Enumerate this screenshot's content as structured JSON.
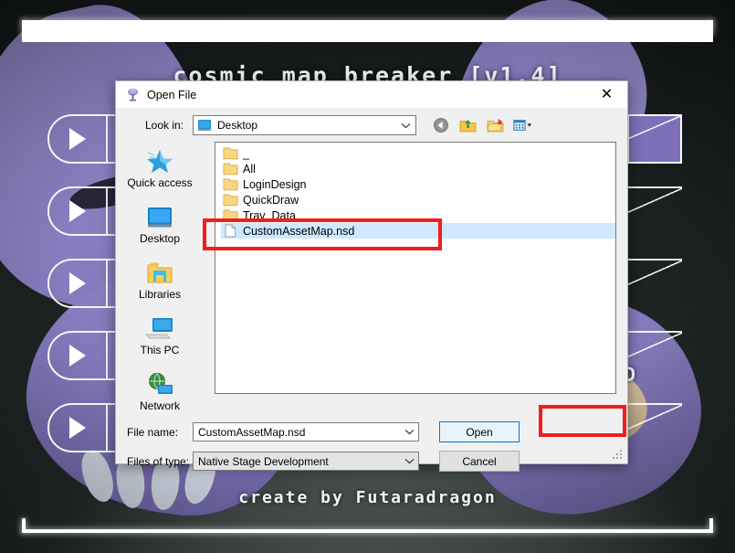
{
  "game": {
    "title": "cosmic map breaker [v1.4]",
    "credit": "create by Futaradragon",
    "hud_label": "[D",
    "menu_buttons": [
      {
        "name": "menu-button-1",
        "icon": "play-triangle-icon"
      },
      {
        "name": "menu-button-2",
        "icon": "play-triangle-icon"
      },
      {
        "name": "menu-button-3",
        "icon": "play-triangle-icon"
      },
      {
        "name": "menu-button-4",
        "icon": "play-triangle-icon"
      },
      {
        "name": "menu-button-5",
        "icon": "play-triangle-icon"
      }
    ]
  },
  "dialog": {
    "title": "Open File",
    "titlebar_icon": "java-duke-icon",
    "close_label": "✕",
    "lookin": {
      "label": "Look in:",
      "value": "Desktop",
      "icon": "desktop-monitor-icon",
      "arrow": "chevron-down-icon"
    },
    "toolbar": [
      {
        "name": "back-button",
        "icon": "back-arrow-icon",
        "tooltip": "Back"
      },
      {
        "name": "up-one-level-button",
        "icon": "up-folder-icon",
        "tooltip": "Up One Level"
      },
      {
        "name": "new-folder-button",
        "icon": "new-folder-icon",
        "tooltip": "Create New Folder"
      },
      {
        "name": "view-menu-button",
        "icon": "list-view-icon",
        "tooltip": "View Menu"
      }
    ],
    "places": [
      {
        "label": "Quick access",
        "icon": "quick-access-star-icon"
      },
      {
        "label": "Desktop",
        "icon": "desktop-monitor-icon"
      },
      {
        "label": "Libraries",
        "icon": "libraries-folder-icon"
      },
      {
        "label": "This PC",
        "icon": "this-pc-icon"
      },
      {
        "label": "Network",
        "icon": "network-globe-icon"
      }
    ],
    "files": [
      {
        "name": "_",
        "type": "folder",
        "selected": false
      },
      {
        "name": "All",
        "type": "folder",
        "selected": false
      },
      {
        "name": "LoginDesign",
        "type": "folder",
        "selected": false
      },
      {
        "name": "QuickDraw",
        "type": "folder",
        "selected": false
      },
      {
        "name": "Trav_Data",
        "type": "folder",
        "selected": false
      },
      {
        "name": "CustomAssetMap.nsd",
        "type": "file",
        "selected": true
      }
    ],
    "form": {
      "file_name_label": "File name:",
      "file_name_value": "CustomAssetMap.nsd",
      "files_of_type_label": "Files of type:",
      "files_of_type_value": "Native Stage Development",
      "open_label": "Open",
      "cancel_label": "Cancel"
    }
  },
  "annotations": {
    "color": "#f01e1e",
    "items": [
      {
        "name": "highlight-selected-file",
        "target": "CustomAssetMap.nsd"
      },
      {
        "name": "highlight-open-button",
        "target": "Open"
      }
    ]
  }
}
